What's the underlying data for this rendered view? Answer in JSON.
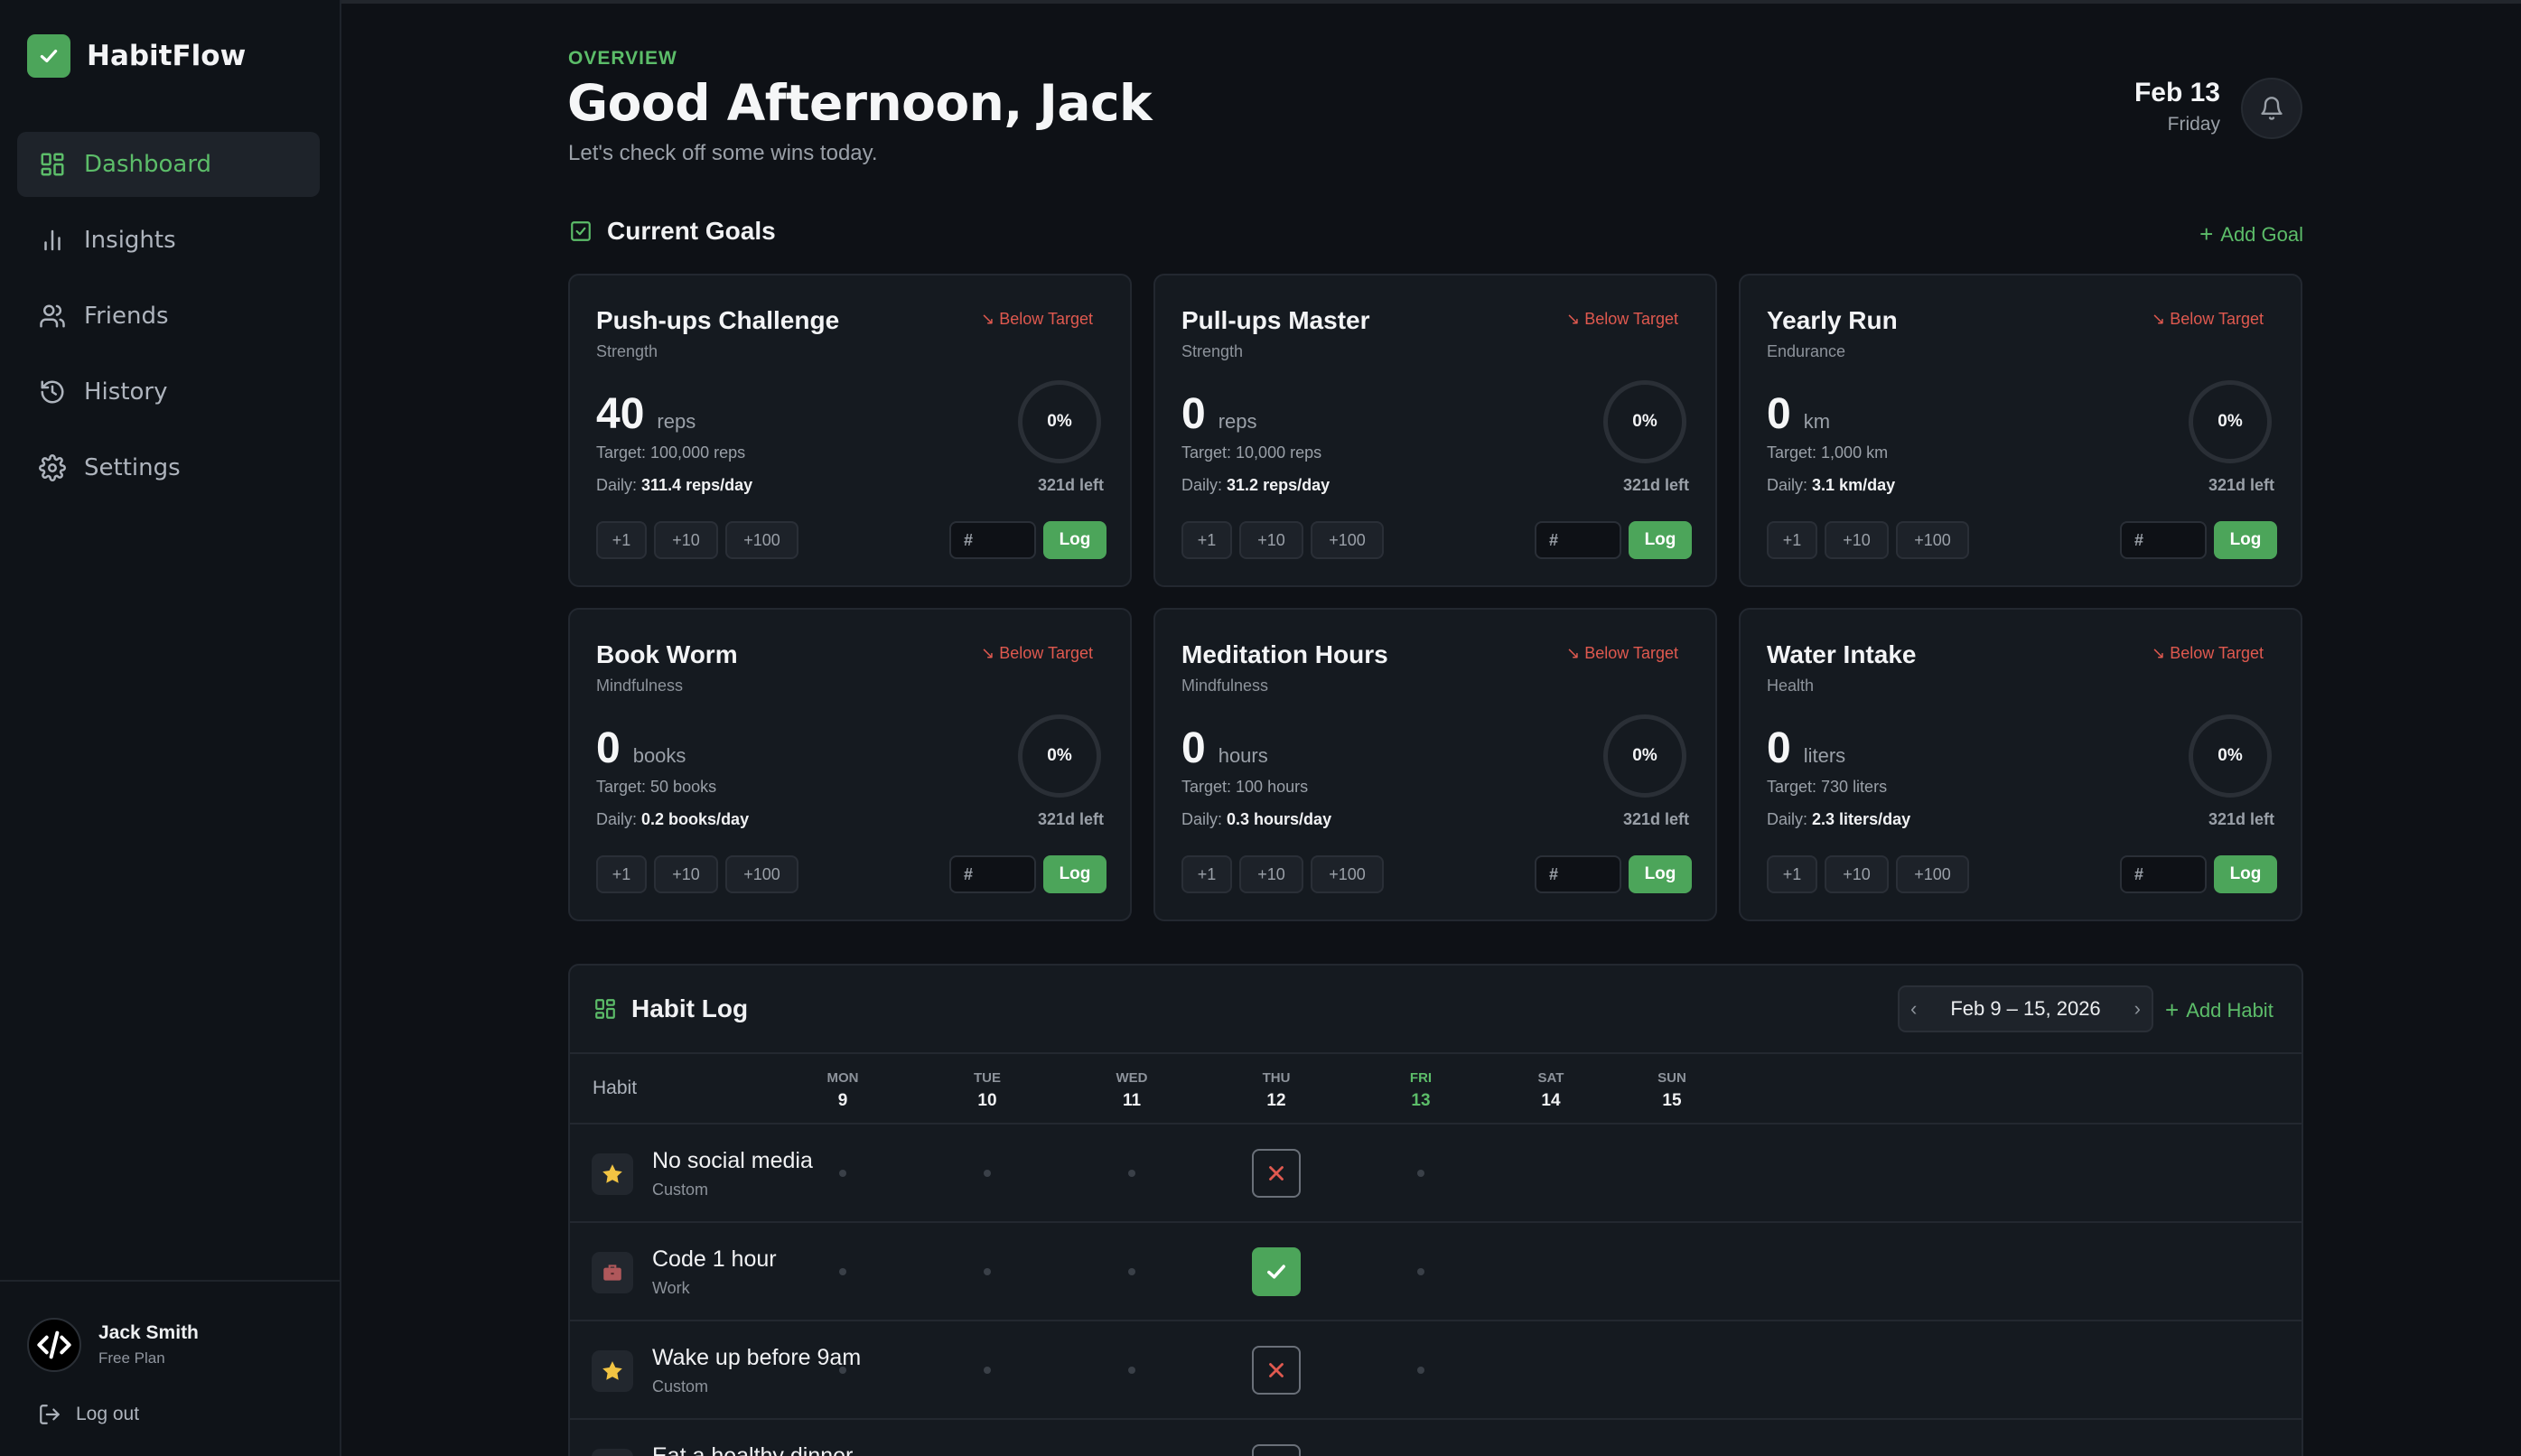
{
  "app": {
    "name": "HabitFlow"
  },
  "nav": [
    {
      "label": "Dashboard",
      "icon": "dashboard-icon",
      "active": true
    },
    {
      "label": "Insights",
      "icon": "bar-chart-icon",
      "active": false
    },
    {
      "label": "Friends",
      "icon": "users-icon",
      "active": false
    },
    {
      "label": "History",
      "icon": "history-icon",
      "active": false
    },
    {
      "label": "Settings",
      "icon": "gear-icon",
      "active": false
    }
  ],
  "user": {
    "name": "Jack Smith",
    "plan": "Free Plan",
    "logout": "Log out"
  },
  "header": {
    "overline": "OVERVIEW",
    "greeting": "Good Afternoon, Jack",
    "subtitle": "Let's check off some wins today.",
    "date": "Feb 13",
    "weekday": "Friday"
  },
  "goals": {
    "title": "Current Goals",
    "add_label": "Add Goal",
    "items": [
      {
        "title": "Push-ups Challenge",
        "category": "Strength",
        "status": "Below Target",
        "value": "40",
        "unit": "reps",
        "target": "Target: 100,000 reps",
        "daily_label": "Daily:",
        "daily": "311.4 reps/day",
        "percent": "0%",
        "left": "321d left"
      },
      {
        "title": "Pull-ups Master",
        "category": "Strength",
        "status": "Below Target",
        "value": "0",
        "unit": "reps",
        "target": "Target: 10,000 reps",
        "daily_label": "Daily:",
        "daily": "31.2 reps/day",
        "percent": "0%",
        "left": "321d left"
      },
      {
        "title": "Yearly Run",
        "category": "Endurance",
        "status": "Below Target",
        "value": "0",
        "unit": "km",
        "target": "Target: 1,000 km",
        "daily_label": "Daily:",
        "daily": "3.1 km/day",
        "percent": "0%",
        "left": "321d left"
      },
      {
        "title": "Book Worm",
        "category": "Mindfulness",
        "status": "Below Target",
        "value": "0",
        "unit": "books",
        "target": "Target: 50 books",
        "daily_label": "Daily:",
        "daily": "0.2 books/day",
        "percent": "0%",
        "left": "321d left"
      },
      {
        "title": "Meditation Hours",
        "category": "Mindfulness",
        "status": "Below Target",
        "value": "0",
        "unit": "hours",
        "target": "Target: 100 hours",
        "daily_label": "Daily:",
        "daily": "0.3 hours/day",
        "percent": "0%",
        "left": "321d left"
      },
      {
        "title": "Water Intake",
        "category": "Health",
        "status": "Below Target",
        "value": "0",
        "unit": "liters",
        "target": "Target: 730 liters",
        "daily_label": "Daily:",
        "daily": "2.3 liters/day",
        "percent": "0%",
        "left": "321d left"
      }
    ],
    "increments": [
      "+1",
      "+10",
      "+100"
    ],
    "input_placeholder": "#",
    "log_label": "Log"
  },
  "habit_log": {
    "title": "Habit Log",
    "week_range": "Feb 9 – 15, 2026",
    "add_label": "Add Habit",
    "column_header": "Habit",
    "days": [
      {
        "name": "MON",
        "date": "9",
        "today": false
      },
      {
        "name": "TUE",
        "date": "10",
        "today": false
      },
      {
        "name": "WED",
        "date": "11",
        "today": false
      },
      {
        "name": "THU",
        "date": "12",
        "today": false
      },
      {
        "name": "FRI",
        "date": "13",
        "today": true
      },
      {
        "name": "SAT",
        "date": "14",
        "today": false
      },
      {
        "name": "SUN",
        "date": "15",
        "today": false
      }
    ],
    "habits": [
      {
        "name": "No social media",
        "category": "Custom",
        "icon": "star-icon",
        "states": [
          "dot",
          "dot",
          "dot",
          "fail",
          "dot",
          "",
          ""
        ]
      },
      {
        "name": "Code 1 hour",
        "category": "Work",
        "icon": "briefcase-icon",
        "states": [
          "dot",
          "dot",
          "dot",
          "done",
          "dot",
          "",
          ""
        ]
      },
      {
        "name": "Wake up before 9am",
        "category": "Custom",
        "icon": "star-icon",
        "states": [
          "dot",
          "dot",
          "dot",
          "fail",
          "dot",
          "",
          ""
        ]
      },
      {
        "name": "Eat a healthy dinner",
        "category": "",
        "icon": "leaf-icon",
        "states": [
          "",
          "",
          "",
          "empty",
          "",
          "",
          ""
        ]
      }
    ]
  },
  "colors": {
    "accent": "#5cbd69",
    "accent_bg": "#4ca55a",
    "warning": "#e0594f",
    "background": "#0e1116",
    "card": "#151a20"
  }
}
